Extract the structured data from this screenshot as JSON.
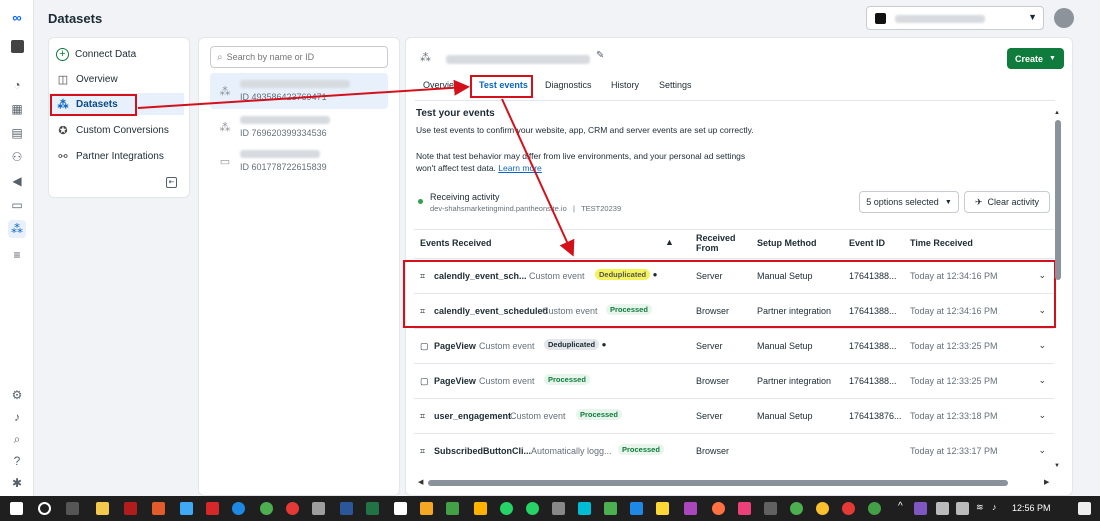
{
  "app": {
    "title": "Datasets"
  },
  "left_rail": {
    "icons": [
      "meta-logo-icon",
      "business-icon",
      "dashboard-icon",
      "table-icon",
      "pages-icon",
      "people-icon",
      "megaphone-icon",
      "billing-icon",
      "events-manager-icon",
      "menu-icon",
      "settings-icon",
      "bell-icon",
      "search-icon",
      "help-icon",
      "bug-icon"
    ]
  },
  "sidebar": {
    "items": [
      {
        "label": "Connect Data",
        "icon": "plus-circle-icon"
      },
      {
        "label": "Overview",
        "icon": "overview-icon"
      },
      {
        "label": "Datasets",
        "icon": "datasets-icon",
        "active": true
      },
      {
        "label": "Custom Conversions",
        "icon": "custom-conversion-icon"
      },
      {
        "label": "Partner Integrations",
        "icon": "handshake-icon"
      }
    ]
  },
  "datasets": {
    "search_placeholder": "Search by name or ID",
    "items": [
      {
        "id": "ID 493586423769471"
      },
      {
        "id": "ID 769620399334536"
      },
      {
        "id": "ID 601778722615839"
      }
    ]
  },
  "main": {
    "create_label": "Create",
    "tabs": [
      "Overview",
      "Test events",
      "Diagnostics",
      "History",
      "Settings"
    ],
    "active_tab": "Test events",
    "section_title": "Test your events",
    "section_desc": "Use test events to confirm your website, app, CRM and server events are set up correctly.",
    "note": "Note that test behavior may differ from live environments, and your personal ad settings",
    "note2": "won't affect test data.",
    "learn_more": "Learn more",
    "receiving": "Receiving activity",
    "receiving_source": "dev-shahsmarketingmind.pantheonsite.io",
    "receiving_sep": "|",
    "receiving_code": "TEST20239",
    "options_label": "5 options selected",
    "clear_label": "Clear activity",
    "columns": {
      "events": "Events Received",
      "from": "Received From",
      "method": "Setup Method",
      "event_id": "Event ID",
      "time": "Time Received"
    },
    "rows": [
      {
        "name": "calendly_event_sch...",
        "type": "Custom event",
        "badge": "Deduplicated",
        "badge_style": "hl",
        "info": true,
        "from": "Server",
        "method": "Manual Setup",
        "event_id": "17641388...",
        "time": "Today at 12:34:16 PM",
        "icon": "tag-icon"
      },
      {
        "name": "calendly_event_scheduled",
        "type": "Custom event",
        "badge": "Processed",
        "badge_style": "proc",
        "info": false,
        "from": "Browser",
        "method": "Partner integration",
        "event_id": "17641388...",
        "time": "Today at 12:34:16 PM",
        "icon": "tag-icon"
      },
      {
        "name": "PageView",
        "type": "Custom event",
        "badge": "Deduplicated",
        "badge_style": "dedup",
        "info": true,
        "from": "Server",
        "method": "Manual Setup",
        "event_id": "17641388...",
        "time": "Today at 12:33:25 PM",
        "icon": "page-icon"
      },
      {
        "name": "PageView",
        "type": "Custom event",
        "badge": "Processed",
        "badge_style": "proc",
        "info": false,
        "from": "Browser",
        "method": "Partner integration",
        "event_id": "17641388...",
        "time": "Today at 12:33:25 PM",
        "icon": "page-icon"
      },
      {
        "name": "user_engagement",
        "type": "Custom event",
        "badge": "Processed",
        "badge_style": "proc",
        "info": false,
        "from": "Server",
        "method": "Manual Setup",
        "event_id": "176413876...",
        "time": "Today at 12:33:18 PM",
        "icon": "tag-icon"
      },
      {
        "name": "SubscribedButtonCli...",
        "type": "Automatically logg...",
        "badge": "Processed",
        "badge_style": "proc",
        "info": false,
        "from": "Browser",
        "method": "",
        "event_id": "",
        "time": "Today at 12:33:17 PM",
        "icon": "tag-icon"
      }
    ]
  },
  "taskbar": {
    "time": "12:56 PM"
  },
  "colors": {
    "accent": "#0a66c2",
    "create": "#0f7b3c",
    "annotation": "#d4111b",
    "highlight": "#f5f35a"
  }
}
